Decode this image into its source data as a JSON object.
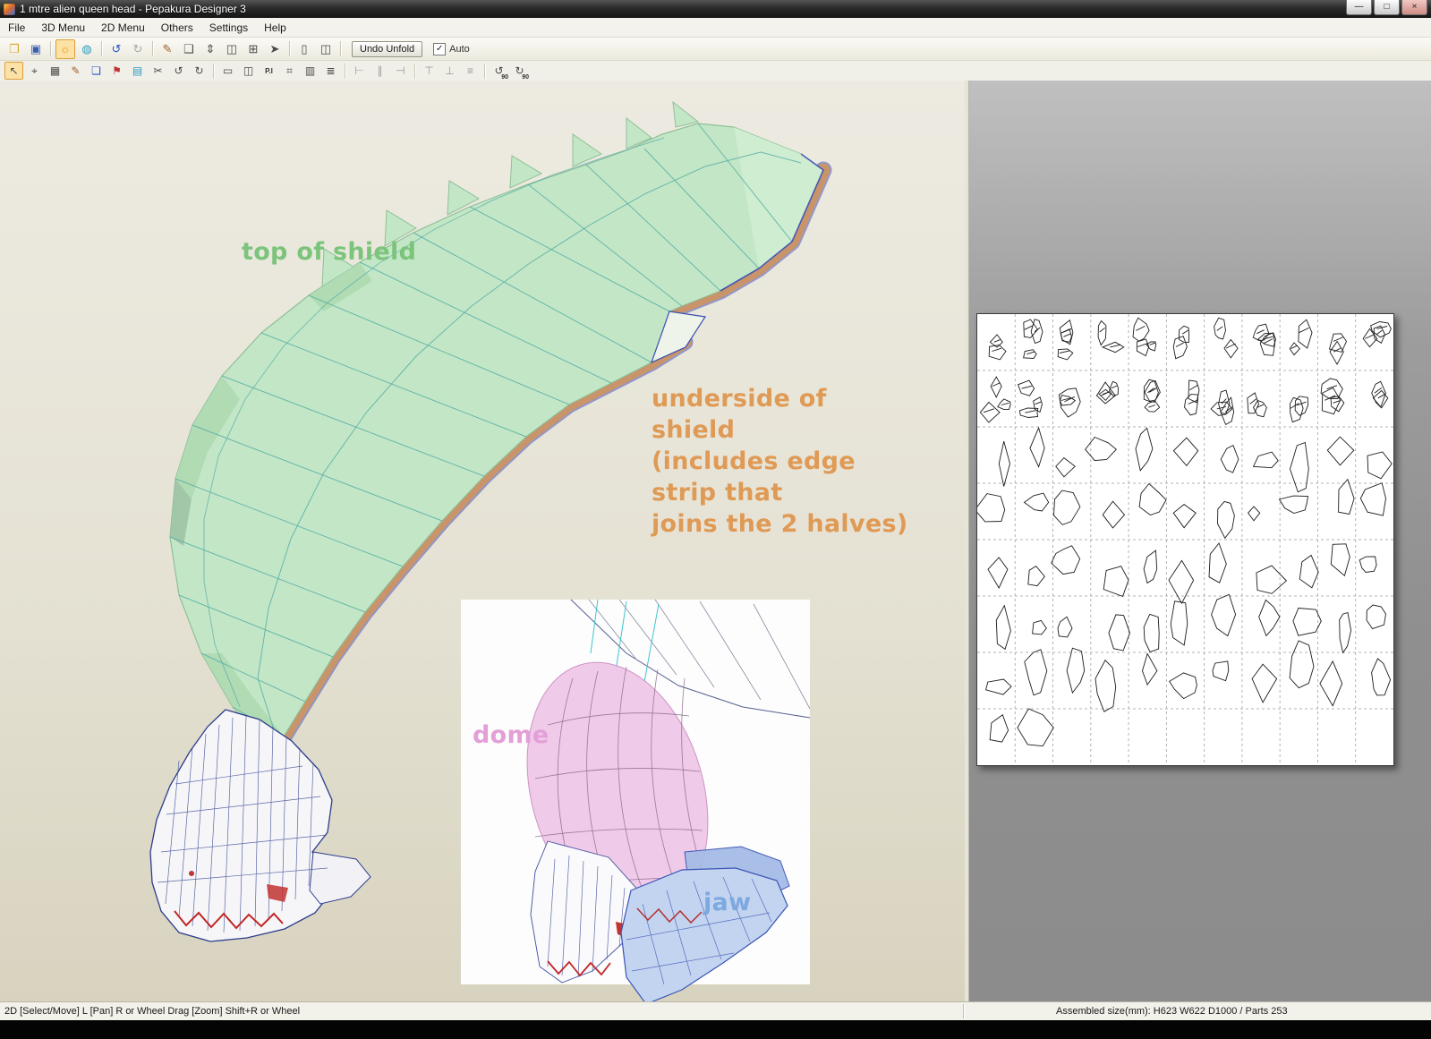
{
  "window": {
    "title": "1 mtre alien queen head - Pepakura Designer 3",
    "minimize": "—",
    "maximize": "□",
    "close": "×"
  },
  "menu": {
    "items": [
      "File",
      "3D Menu",
      "2D Menu",
      "Others",
      "Settings",
      "Help"
    ]
  },
  "toolbar_top": {
    "icons": [
      {
        "name": "open-folder-icon",
        "glyph": "❒"
      },
      {
        "name": "save-icon",
        "glyph": "▣"
      },
      {
        "name": "light-bulb-icon",
        "glyph": "☼"
      },
      {
        "name": "texture-view-icon",
        "glyph": "◍"
      },
      {
        "name": "undo-icon",
        "glyph": "↺"
      },
      {
        "name": "redo-icon",
        "glyph": "↻"
      },
      {
        "name": "pencil-icon",
        "glyph": "✎"
      },
      {
        "name": "box-icon",
        "glyph": "❑"
      },
      {
        "name": "move-vertical-icon",
        "glyph": "⇕"
      },
      {
        "name": "split-window-icon",
        "glyph": "◫"
      },
      {
        "name": "new-window-icon",
        "glyph": "⊞"
      },
      {
        "name": "pointer-mode-icon",
        "glyph": "➤"
      },
      {
        "name": "view-3d-only-icon",
        "glyph": "▯"
      },
      {
        "name": "view-both-icon",
        "glyph": "◫"
      }
    ],
    "undo_unfold": "Undo Unfold",
    "auto_label": "Auto",
    "auto_check": "✓"
  },
  "toolbar_2d": {
    "icons": [
      {
        "name": "select-move-icon",
        "glyph": "↖"
      },
      {
        "name": "target-icon",
        "glyph": "⌖"
      },
      {
        "name": "grid-icon",
        "glyph": "▦"
      },
      {
        "name": "pen-icon",
        "glyph": "✎"
      },
      {
        "name": "pages-icon",
        "glyph": "❏"
      },
      {
        "name": "flag-icon",
        "glyph": "⚑"
      },
      {
        "name": "image-icon",
        "glyph": "▤"
      },
      {
        "name": "scissors-icon",
        "glyph": "✂"
      },
      {
        "name": "rotate-ccw-icon",
        "glyph": "↺"
      },
      {
        "name": "rotate-cw-icon",
        "glyph": "↻"
      },
      {
        "name": "select-rect-icon",
        "glyph": "▭"
      },
      {
        "name": "join-parts-icon",
        "glyph": "◫"
      },
      {
        "name": "part-id-icon",
        "glyph": "P.I"
      },
      {
        "name": "edge-id-icon",
        "glyph": "⌗"
      },
      {
        "name": "table-icon",
        "glyph": "▥"
      },
      {
        "name": "print-layout-icon",
        "glyph": "≣"
      },
      {
        "name": "align-left-icon",
        "glyph": "⊢"
      },
      {
        "name": "align-center-icon",
        "glyph": "∥"
      },
      {
        "name": "align-right-icon",
        "glyph": "⊣"
      },
      {
        "name": "align-top-icon",
        "glyph": "⊤"
      },
      {
        "name": "align-bottom-icon",
        "glyph": "⊥"
      },
      {
        "name": "distribute-icon",
        "glyph": "≡"
      },
      {
        "name": "rotate-left-90-icon",
        "glyph": "↺",
        "label": "90"
      },
      {
        "name": "rotate-right-90-icon",
        "glyph": "↻",
        "label": "90"
      }
    ]
  },
  "viewport": {
    "annotations": {
      "top_shield": {
        "text": "top of shield",
        "color": "#7cc47c"
      },
      "underside": {
        "text": "underside of shield\n(includes edge strip that\njoins the 2 halves)",
        "color": "#df9a55"
      },
      "dome": {
        "text": "dome",
        "color": "#e39fd7"
      },
      "jaw": {
        "text": "jaw",
        "color": "#7ea9e0"
      }
    }
  },
  "statusbar": {
    "left": "2D [Select/Move] L [Pan] R or Wheel Drag [Zoom] Shift+R or Wheel",
    "right": "Assembled size(mm): H623 W622 D1000 / Parts 253"
  }
}
